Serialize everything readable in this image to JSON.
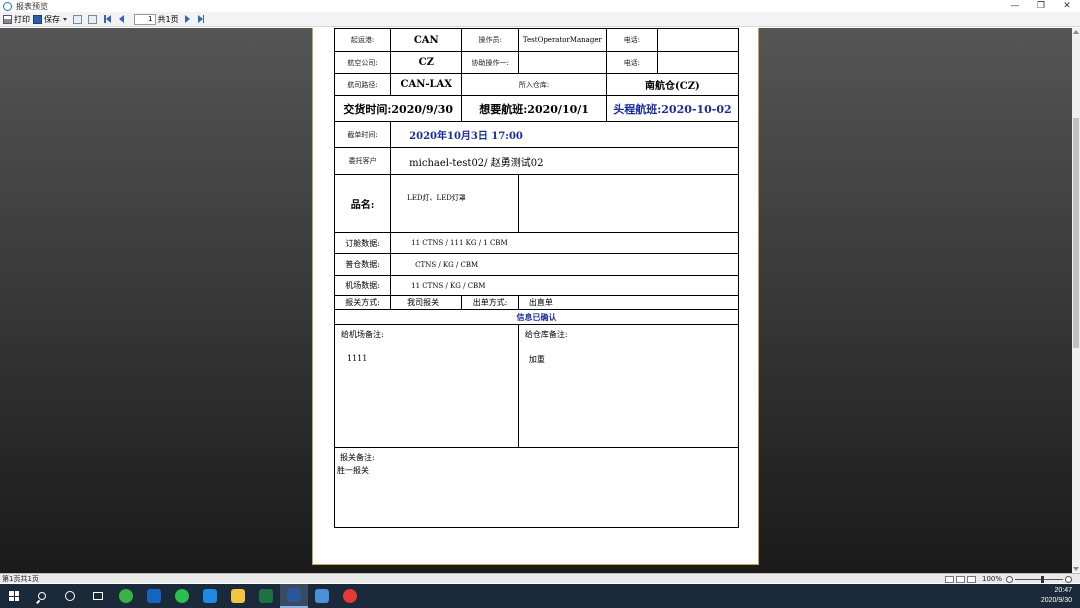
{
  "window": {
    "title": "报表预览",
    "minimize": "—",
    "maximize": "❐",
    "close": "✕"
  },
  "toolbar": {
    "print_label": "打印",
    "save_label": "保存",
    "page_value": "1",
    "page_total": "共1页"
  },
  "form": {
    "row1": {
      "label1": "起运港:",
      "value1": "CAN",
      "label2": "操作员:",
      "value2": "TestOperatorManager",
      "label3": "电话:",
      "value3": ""
    },
    "row2": {
      "label1": "航空公司:",
      "value1": "CZ",
      "label2": "协助操作一:",
      "value2": "",
      "label3": "电话:",
      "value3": ""
    },
    "row3": {
      "label1": "航司路径:",
      "value1": "CAN-LAX",
      "label2": "所入仓库:",
      "value2": "南航仓(CZ)"
    },
    "row4": {
      "delivery": "交货时间:2020/9/30",
      "wanted_flight": "想要航班:2020/10/1",
      "first_flight": "头程航班:2020-10-02"
    },
    "cutoff": {
      "label": "截单时间:",
      "value": "2020年10月3日 17:00"
    },
    "client": {
      "label": "委托客户",
      "value": "michael-test02/  赵勇测试02"
    },
    "product": {
      "label": "品名:",
      "value": "LED灯、LED灯罩",
      "extra": ""
    },
    "booking": {
      "label": "订舱数据:",
      "value": "11 CTNS  /  111  KG  /  1 CBM"
    },
    "warehouse_in": {
      "label": "普仓数据:",
      "value": "CTNS  /   KG  /   CBM"
    },
    "airport": {
      "label": "机场数据:",
      "value": "11 CTNS  /   KG  /   CBM"
    },
    "customs": {
      "label": "报关方式:",
      "value": "我司报关",
      "label2": "出单方式:",
      "value2": "出直单"
    },
    "confirm": "信息已确认",
    "airport_note": {
      "label": "给机场备注:",
      "value": "1111"
    },
    "warehouse_note": {
      "label": "给仓库备注:",
      "value": "加重"
    },
    "customs_note": {
      "label": "报关备注:",
      "value": "胜一报关"
    }
  },
  "statusbar": {
    "left": "第1页共1页",
    "zoom": "100%"
  },
  "taskbar": {
    "time": "20:47",
    "date": "2020/9/30",
    "apps": [
      {
        "name": "360-browser",
        "color": "#3cb043"
      },
      {
        "name": "outlook",
        "color": "#1565c0"
      },
      {
        "name": "wechat",
        "color": "#2bbf4b"
      },
      {
        "name": "edge-search",
        "color": "#1e88e5"
      },
      {
        "name": "file-explorer",
        "color": "#f4c542"
      },
      {
        "name": "excel",
        "color": "#1e7145"
      },
      {
        "name": "word",
        "color": "#2b579a"
      },
      {
        "name": "app-blue",
        "color": "#4a90d9"
      },
      {
        "name": "recorder",
        "color": "#e53935"
      }
    ]
  }
}
